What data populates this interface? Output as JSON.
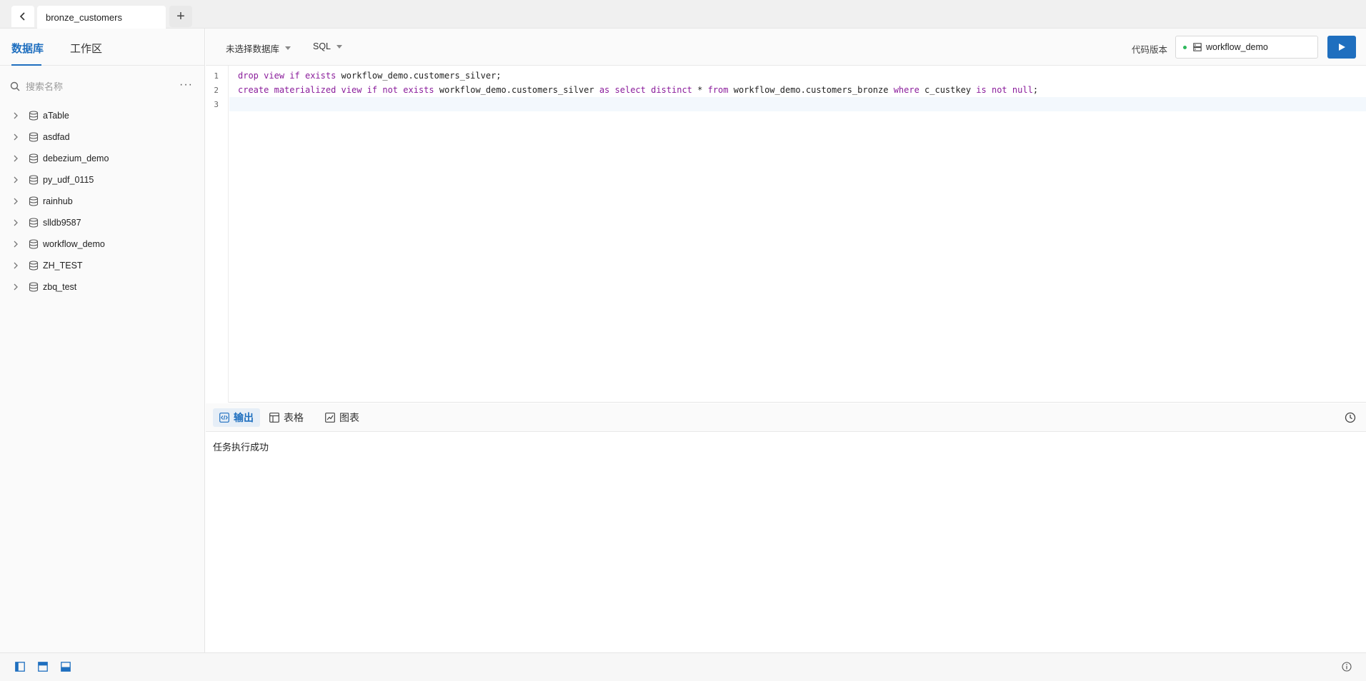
{
  "tabs": {
    "back_icon": "chevron-left-icon",
    "active_tab": "bronze_customers",
    "add_label": "+"
  },
  "sidebar": {
    "tabs": [
      "数据库",
      "工作区"
    ],
    "active_tab": 0,
    "search_placeholder": "搜索名称",
    "more_label": "···",
    "databases": [
      "aTable",
      "asdfad",
      "debezium_demo",
      "py_udf_0115",
      "rainhub",
      "slldb9587",
      "workflow_demo",
      "ZH_TEST",
      "zbq_test"
    ]
  },
  "toolbar": {
    "database_select": "未选择数据库",
    "language_select": "SQL",
    "version_label": "代码版本",
    "version_value": "workflow_demo",
    "accent_color": "#1f6fbf"
  },
  "editor": {
    "line_numbers": [
      "1",
      "2",
      "3"
    ],
    "lines": [
      "drop view if exists workflow_demo.customers_silver;",
      "create materialized view if not exists workflow_demo.customers_silver as select distinct * from workflow_demo.customers_bronze where c_custkey is not null;",
      ""
    ]
  },
  "result": {
    "tabs": [
      "输出",
      "表格",
      "图表"
    ],
    "active_tab": 0,
    "message": "任务执行成功"
  }
}
